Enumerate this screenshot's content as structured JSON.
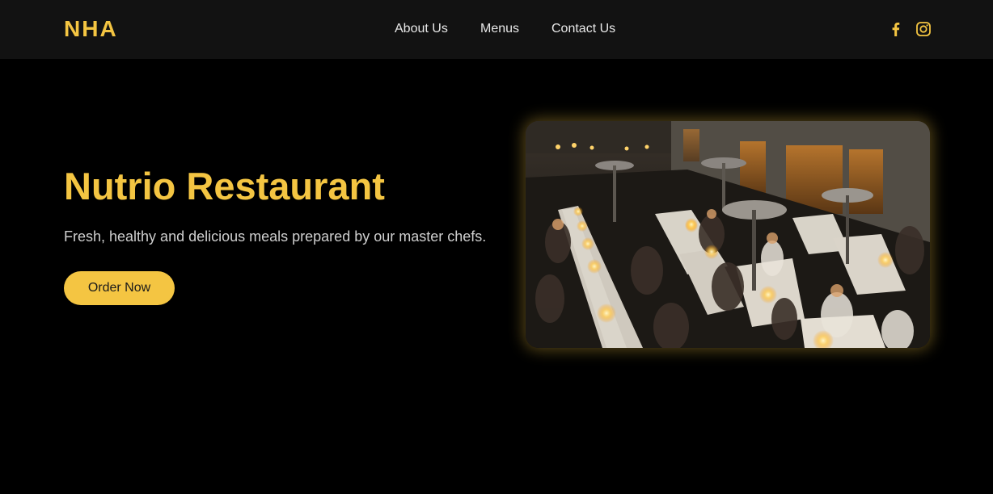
{
  "brand": {
    "logo_text": "NHA",
    "accent_color": "#f4c542"
  },
  "nav": {
    "links": [
      {
        "label": "About Us"
      },
      {
        "label": "Menus"
      },
      {
        "label": "Contact Us"
      }
    ]
  },
  "social": {
    "icons": [
      "facebook-icon",
      "instagram-icon"
    ]
  },
  "hero": {
    "title": "Nutrio Restaurant",
    "subtitle": "Fresh, healthy and delicious meals prepared by our master chefs.",
    "cta_label": "Order Now",
    "image_description_icon": "restaurant-photo"
  },
  "colors": {
    "background": "#000000",
    "navbar": "#121212",
    "text_light": "#e8e8e8"
  }
}
